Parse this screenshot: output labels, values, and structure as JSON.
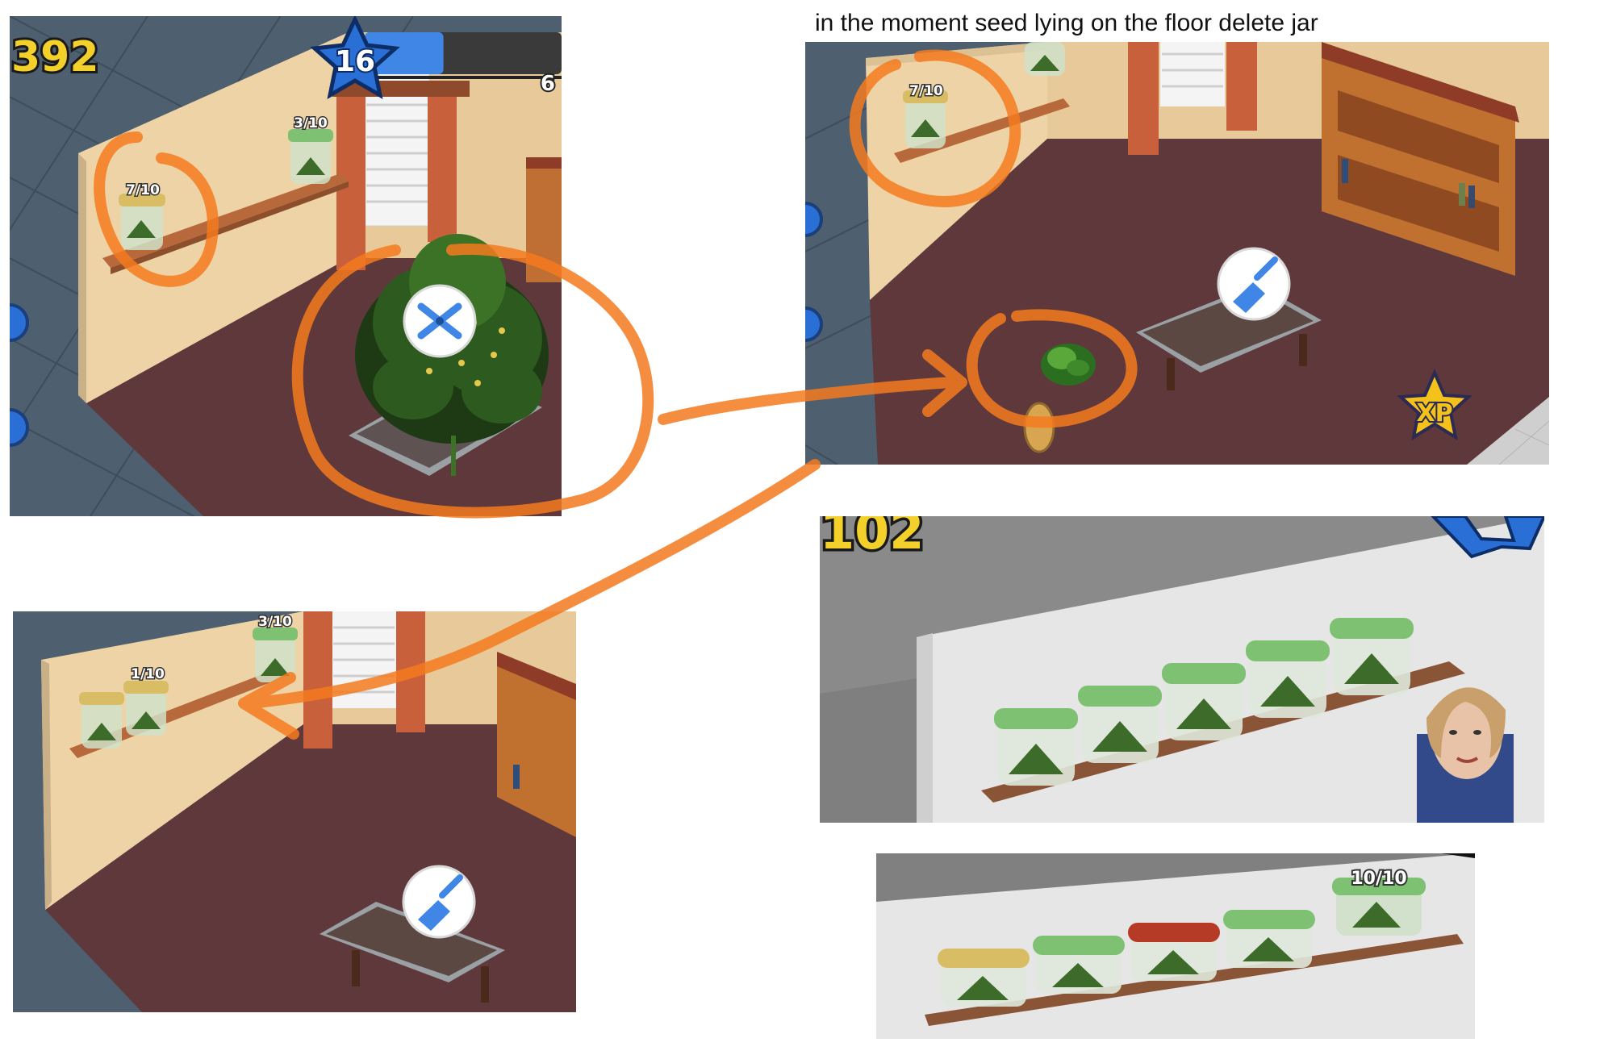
{
  "caption": "in the moment seed lying on the floor delete jar",
  "colors": {
    "annotation": "#f47a1f",
    "wall": "#eed3a6",
    "floor": "#5e383b",
    "shelf": "#b8693b",
    "jar_lid_green": "#7fc173",
    "jar_lid_yellow": "#d8bd65",
    "jar_lid_red": "#b63b26",
    "tool_icon": "#3f86e6",
    "xp_gold": "#f4c21a"
  },
  "panel1": {
    "score": "392",
    "level": "16",
    "xp_fragment": "6",
    "level_progress": 0.4,
    "jar_left_count": "7/10",
    "jar_right_count": "3/10",
    "tool_icon": "pruning-shears-icon"
  },
  "panel2": {
    "jar_count": "7/10",
    "tool_icon": "trowel-icon",
    "xp_label": "XP"
  },
  "panel3": {
    "jar_left_count": "1/10",
    "jar_right_count": "3/10",
    "tool_icon": "trowel-icon"
  },
  "panel4": {
    "score_fragment": "102",
    "jar_count": 5
  },
  "panel5": {
    "jar_full_count": "10/10",
    "jar_lids": [
      "yellow",
      "green",
      "red",
      "green"
    ]
  }
}
